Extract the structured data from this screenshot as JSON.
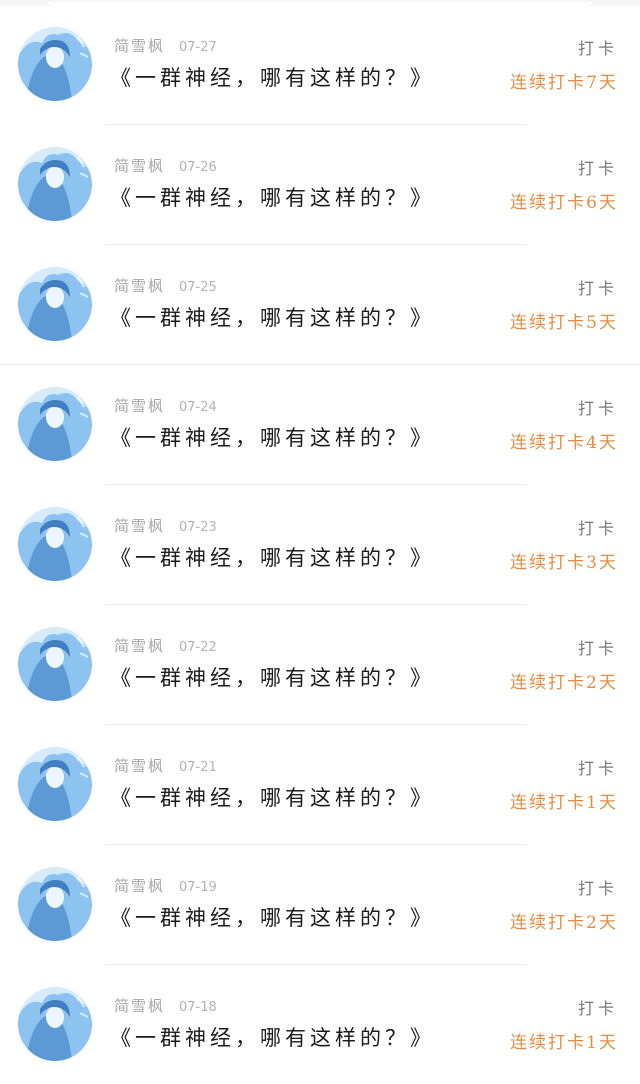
{
  "feed": {
    "items": [
      {
        "author": "简雪枫",
        "date": "07-27",
        "title": "《一群神经，哪有这样的？》",
        "tag": "打卡",
        "streak": "连续打卡7天"
      },
      {
        "author": "简雪枫",
        "date": "07-26",
        "title": "《一群神经，哪有这样的？》",
        "tag": "打卡",
        "streak": "连续打卡6天"
      },
      {
        "author": "简雪枫",
        "date": "07-25",
        "title": "《一群神经，哪有这样的？》",
        "tag": "打卡",
        "streak": "连续打卡5天"
      },
      {
        "author": "简雪枫",
        "date": "07-24",
        "title": "《一群神经，哪有这样的？》",
        "tag": "打卡",
        "streak": "连续打卡4天"
      },
      {
        "author": "简雪枫",
        "date": "07-23",
        "title": "《一群神经，哪有这样的？》",
        "tag": "打卡",
        "streak": "连续打卡3天"
      },
      {
        "author": "简雪枫",
        "date": "07-22",
        "title": "《一群神经，哪有这样的？》",
        "tag": "打卡",
        "streak": "连续打卡2天"
      },
      {
        "author": "简雪枫",
        "date": "07-21",
        "title": "《一群神经，哪有这样的？》",
        "tag": "打卡",
        "streak": "连续打卡1天"
      },
      {
        "author": "简雪枫",
        "date": "07-19",
        "title": "《一群神经，哪有这样的？》",
        "tag": "打卡",
        "streak": "连续打卡2天"
      },
      {
        "author": "简雪枫",
        "date": "07-18",
        "title": "《一群神经，哪有这样的？》",
        "tag": "打卡",
        "streak": "连续打卡1天"
      }
    ]
  },
  "colors": {
    "streak_accent": "#e48c43",
    "meta_gray": "#a7a7a7",
    "title_text": "#1c1c1c"
  }
}
